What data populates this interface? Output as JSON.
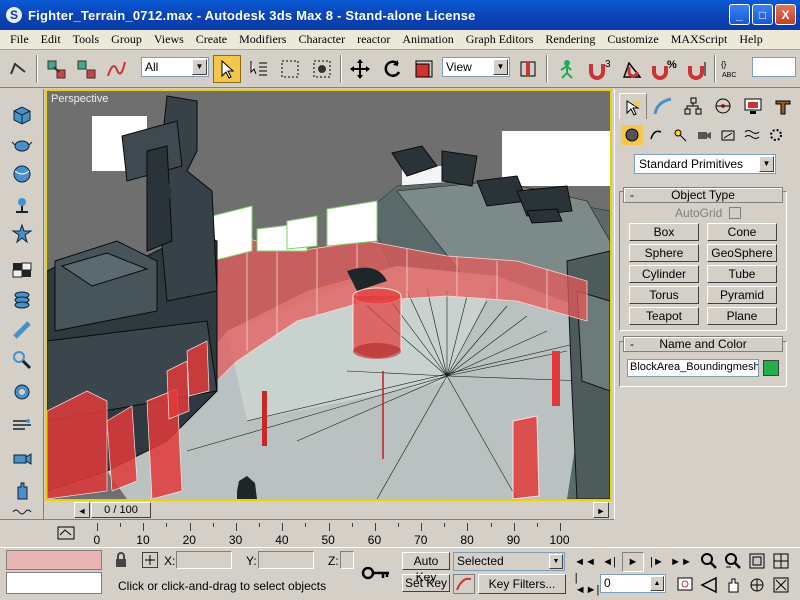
{
  "window": {
    "title": "Fighter_Terrain_0712.max - Autodesk 3ds Max 8  - Stand-alone License",
    "minimize": "_",
    "maximize": "□",
    "close": "X"
  },
  "menu": [
    "File",
    "Edit",
    "Tools",
    "Group",
    "Views",
    "Create",
    "Modifiers",
    "Character",
    "reactor",
    "Animation",
    "Graph Editors",
    "Rendering",
    "Customize",
    "MAXScript",
    "Help"
  ],
  "toolbar": {
    "selection_filter": "All",
    "reference_coord": "View",
    "snap_count": "3",
    "angle_snap_pct": "%"
  },
  "viewport": {
    "label": "Perspective",
    "border_color": "#e8d400"
  },
  "command_panel": {
    "category": "Standard Primitives",
    "object_type_header": "Object Type",
    "autogrid_label": "AutoGrid",
    "primitives": [
      "Box",
      "Cone",
      "Sphere",
      "GeoSphere",
      "Cylinder",
      "Tube",
      "Torus",
      "Pyramid",
      "Teapot",
      "Plane"
    ],
    "name_color_header": "Name and Color",
    "object_name": "BlockArea_Boundingmesh",
    "object_color": "#22b14c",
    "rollout_minus": "-"
  },
  "timeline": {
    "position": "0 / 100",
    "ticks": [
      "0",
      "10",
      "20",
      "30",
      "40",
      "50",
      "60",
      "70",
      "80",
      "90",
      "100"
    ]
  },
  "status": {
    "x_label": "X:",
    "y_label": "Y:",
    "z_label": "Z:",
    "prompt": "Click or click-and-drag to select objects",
    "auto_key": "Auto Key",
    "set_key": "Set Key",
    "selected_filter": "Selected",
    "key_filters": "Key Filters...",
    "current_frame": "0"
  },
  "icons": {
    "toolbar": [
      "undo-icon",
      "link-icon",
      "unlink-icon",
      "bind-space-warp-icon",
      "select-object-icon",
      "select-by-name-icon",
      "rect-selection-icon",
      "window-crossing-icon",
      "move-icon",
      "rotate-icon",
      "scale-icon",
      "pivot-icon",
      "manipulate-icon",
      "snap-icon",
      "angle-snap-icon",
      "percent-snap-icon",
      "spinner-snap-icon",
      "named-selection-icon"
    ],
    "left_strip": [
      "box-tool-icon",
      "teapot-tool-icon",
      "sphere-tool-icon",
      "light-tool-icon",
      "character-tool-icon",
      "checker-tool-icon",
      "stack-tool-icon",
      "bone-tool-icon",
      "shape-tool-icon",
      "gear-tool-icon",
      "wind-tool-icon",
      "camera-tool-icon",
      "hand-tool-icon",
      "wave-tool-icon"
    ]
  }
}
